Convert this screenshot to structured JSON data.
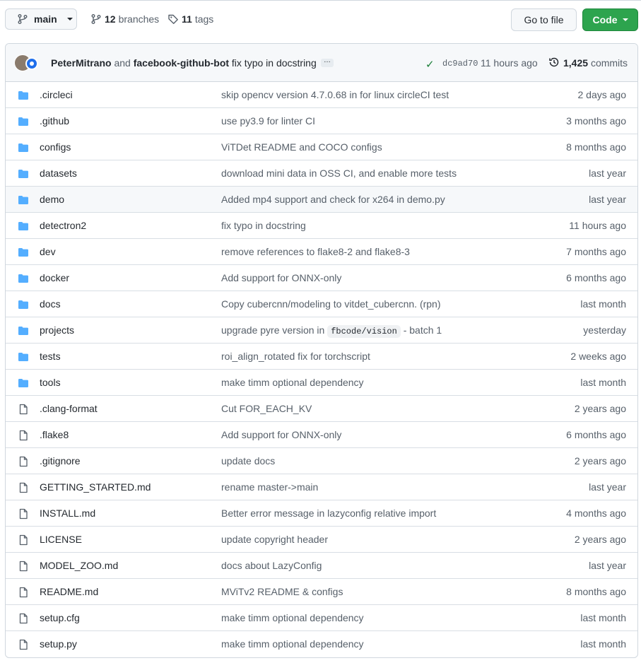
{
  "branch": {
    "name": "main"
  },
  "branches": {
    "count": "12",
    "label": "branches"
  },
  "tags": {
    "count": "11",
    "label": "tags"
  },
  "buttons": {
    "goto": "Go to file",
    "code": "Code"
  },
  "commit": {
    "author1": "PeterMitrano",
    "and": "and",
    "author2": "facebook-github-bot",
    "message": "fix typo in docstring",
    "ellipsis": "…",
    "sha": "dc9ad70",
    "time": "11 hours ago",
    "count": "1,425",
    "count_label": "commits"
  },
  "colors": {
    "folder": "#54aeff",
    "file": "#57606a",
    "accent": "#2da44e"
  },
  "files": [
    {
      "name": ".circleci",
      "type": "folder",
      "msg": "skip opencv version 4.7.0.68 in for linux circleCI test",
      "age": "2 days ago"
    },
    {
      "name": ".github",
      "type": "folder",
      "msg": "use py3.9 for linter CI",
      "age": "3 months ago"
    },
    {
      "name": "configs",
      "type": "folder",
      "msg": "ViTDet README and COCO configs",
      "age": "8 months ago"
    },
    {
      "name": "datasets",
      "type": "folder",
      "msg": "download mini data in OSS CI, and enable more tests",
      "age": "last year"
    },
    {
      "name": "demo",
      "type": "folder",
      "msg": "Added mp4 support and check for x264 in demo.py",
      "age": "last year"
    },
    {
      "name": "detectron2",
      "type": "folder",
      "msg": "fix typo in docstring",
      "age": "11 hours ago"
    },
    {
      "name": "dev",
      "type": "folder",
      "msg": "remove references to flake8-2 and flake8-3",
      "age": "7 months ago"
    },
    {
      "name": "docker",
      "type": "folder",
      "msg": "Add support for ONNX-only",
      "age": "6 months ago"
    },
    {
      "name": "docs",
      "type": "folder",
      "msg": "Copy cubercnn/modeling to vitdet_cubercnn. (rpn)",
      "age": "last month"
    },
    {
      "name": "projects",
      "type": "folder",
      "msg": "upgrade pyre version in",
      "msg_code": "fbcode/vision",
      "msg_after": "- batch 1",
      "age": "yesterday"
    },
    {
      "name": "tests",
      "type": "folder",
      "msg": "roi_align_rotated fix for torchscript",
      "age": "2 weeks ago"
    },
    {
      "name": "tools",
      "type": "folder",
      "msg": "make timm optional dependency",
      "age": "last month"
    },
    {
      "name": ".clang-format",
      "type": "file",
      "msg": "Cut FOR_EACH_KV",
      "age": "2 years ago"
    },
    {
      "name": ".flake8",
      "type": "file",
      "msg": "Add support for ONNX-only",
      "age": "6 months ago"
    },
    {
      "name": ".gitignore",
      "type": "file",
      "msg": "update docs",
      "age": "2 years ago"
    },
    {
      "name": "GETTING_STARTED.md",
      "type": "file",
      "msg": "rename master->main",
      "age": "last year"
    },
    {
      "name": "INSTALL.md",
      "type": "file",
      "msg": "Better error message in lazyconfig relative import",
      "age": "4 months ago"
    },
    {
      "name": "LICENSE",
      "type": "file",
      "msg": "update copyright header",
      "age": "2 years ago"
    },
    {
      "name": "MODEL_ZOO.md",
      "type": "file",
      "msg": "docs about LazyConfig",
      "age": "last year"
    },
    {
      "name": "README.md",
      "type": "file",
      "msg": "MViTv2 README & configs",
      "age": "8 months ago"
    },
    {
      "name": "setup.cfg",
      "type": "file",
      "msg": "make timm optional dependency",
      "age": "last month"
    },
    {
      "name": "setup.py",
      "type": "file",
      "msg": "make timm optional dependency",
      "age": "last month"
    }
  ]
}
